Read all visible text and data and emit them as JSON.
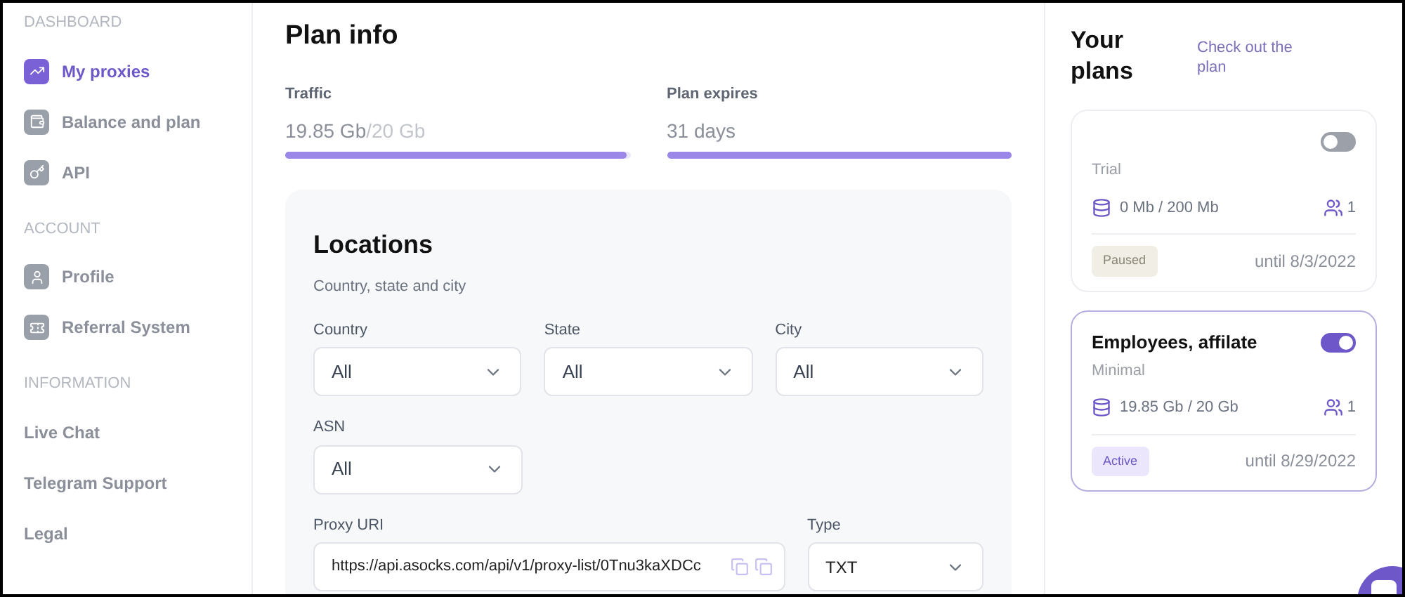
{
  "sidebar": {
    "sections": [
      {
        "heading": "DASHBOARD",
        "items": [
          {
            "label": "My proxies",
            "selected": true
          },
          {
            "label": "Balance and plan",
            "selected": false
          },
          {
            "label": "API",
            "selected": false
          }
        ]
      },
      {
        "heading": "ACCOUNT",
        "items": [
          {
            "label": "Profile",
            "selected": false
          },
          {
            "label": "Referral System",
            "selected": false
          }
        ]
      },
      {
        "heading": "INFORMATION",
        "items": [
          {
            "label": "Live Chat",
            "selected": false
          },
          {
            "label": "Telegram Support",
            "selected": false
          },
          {
            "label": "Legal",
            "selected": false
          }
        ]
      }
    ]
  },
  "plan_info": {
    "title": "Plan info",
    "meters": [
      {
        "label": "Traffic",
        "value": "19.85 Gb",
        "total": "/20 Gb",
        "level": 0.99
      },
      {
        "label": "Plan expires",
        "value": "31 days",
        "level": 1
      }
    ]
  },
  "locations": {
    "title": "Locations",
    "subtitle": "Country, state and city",
    "selects": [
      {
        "label": "Country",
        "value": "All"
      },
      {
        "label": "State",
        "value": "All"
      },
      {
        "label": "City",
        "value": "All"
      },
      {
        "label": "ASN",
        "value": "All"
      }
    ],
    "proxy_uri": {
      "label": "Proxy URI",
      "value": "https://api.asocks.com/api/v1/proxy-list/0Tnu3kaXDCc"
    },
    "type": {
      "label": "Type",
      "value": "TXT"
    }
  },
  "plans_panel": {
    "title": "Your plans",
    "link": "Check out the plan",
    "plans": [
      {
        "type": "Trial",
        "usage": "0 Mb / 200 Mb",
        "users": "1",
        "status": "Paused",
        "active": false,
        "until": "until 8/3/2022",
        "on": false,
        "selected": false
      },
      {
        "name": "Employees, affilate",
        "type": "Minimal",
        "usage": "19.85 Gb / 20 Gb",
        "users": "1",
        "status": "Active",
        "active": true,
        "until": "until 8/29/2022",
        "on": true,
        "selected": true
      }
    ]
  }
}
